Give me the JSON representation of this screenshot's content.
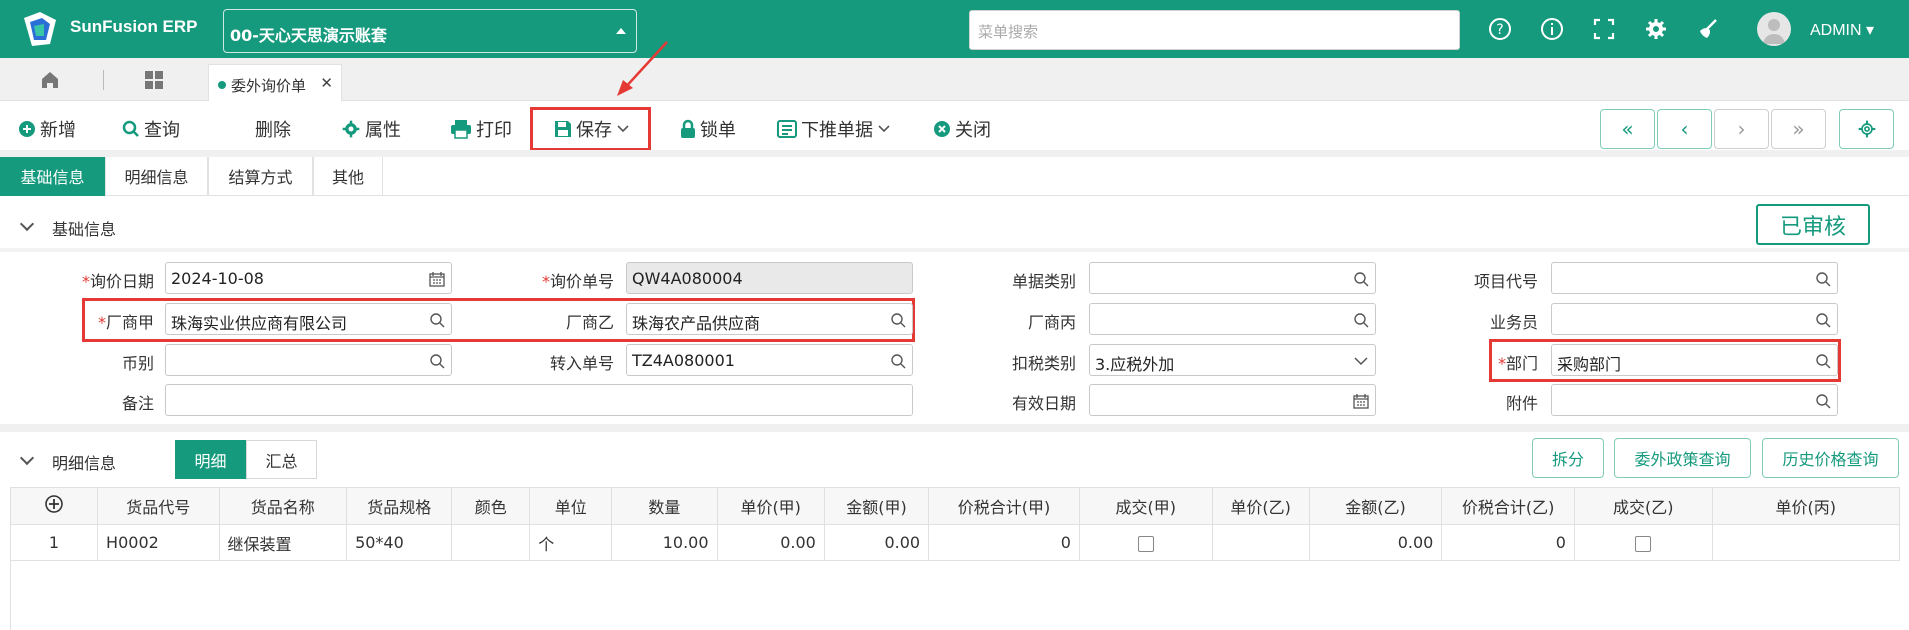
{
  "app": {
    "logo_text": "SunFusion ERP",
    "account": "00-天心天思演示账套",
    "search_placeholder": "菜单搜索",
    "user": "ADMIN"
  },
  "tabs": {
    "active": "委外询价单"
  },
  "toolbar": {
    "new": "新增",
    "query": "查询",
    "delete": "删除",
    "props": "属性",
    "print": "打印",
    "save": "保存",
    "lock": "锁单",
    "push": "下推单据",
    "close": "关闭"
  },
  "section_tabs": [
    "基础信息",
    "明细信息",
    "结算方式",
    "其他"
  ],
  "basic": {
    "title": "基础信息",
    "status": "已审核",
    "fields": {
      "date_label": "询价日期",
      "date": "2024-10-08",
      "no_label": "询价单号",
      "no": "QW4A080004",
      "doctype_label": "单据类别",
      "doctype": "",
      "project_label": "项目代号",
      "project": "",
      "vendor_a_label": "厂商甲",
      "vendor_a": "珠海实业供应商有限公司",
      "vendor_b_label": "厂商乙",
      "vendor_b": "珠海农产品供应商",
      "vendor_c_label": "厂商丙",
      "vendor_c": "",
      "sales_label": "业务员",
      "sales": "",
      "currency_label": "币别",
      "currency": "",
      "transfer_label": "转入单号",
      "transfer": "TZ4A080001",
      "tax_label": "扣税类别",
      "tax": "3.应税外加",
      "dept_label": "部门",
      "dept": "采购部门",
      "remark_label": "备注",
      "remark": "",
      "valid_label": "有效日期",
      "valid": "",
      "attach_label": "附件",
      "attach": ""
    }
  },
  "detail": {
    "title": "明细信息",
    "view_detail": "明细",
    "view_summary": "汇总",
    "btn_split": "拆分",
    "btn_policy": "委外政策查询",
    "btn_history": "历史价格查询",
    "columns": [
      "货品代号",
      "货品名称",
      "货品规格",
      "颜色",
      "单位",
      "数量",
      "单价(甲)",
      "金额(甲)",
      "价税合计(甲)",
      "成交(甲)",
      "单价(乙)",
      "金额(乙)",
      "价税合计(乙)",
      "成交(乙)",
      "单价(丙)"
    ],
    "rows": [
      {
        "idx": "1",
        "code": "H0002",
        "name": "继保装置",
        "spec": "50*40",
        "color": "",
        "unit": "个",
        "qty": "10.00",
        "price_a": "0.00",
        "amt_a": "0.00",
        "total_a": "0",
        "price_b": "",
        "amt_b": "0.00",
        "total_b": "0",
        "price_c": ""
      }
    ]
  },
  "colors": {
    "brand": "#169a7e",
    "highlight": "#e53935"
  }
}
